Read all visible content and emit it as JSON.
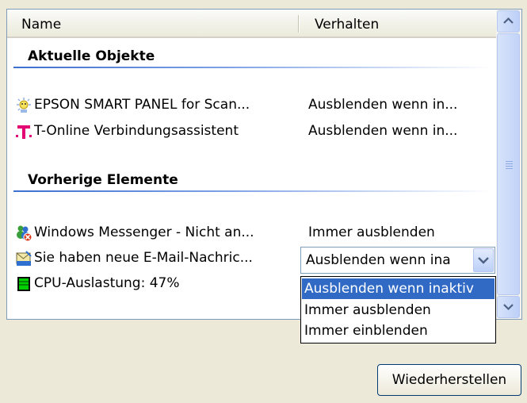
{
  "columns": {
    "name": "Name",
    "behavior": "Verhalten"
  },
  "groups": [
    {
      "title": "Aktuelle Objekte"
    },
    {
      "title": "Vorherige Elemente"
    }
  ],
  "current_items": [
    {
      "name": "EPSON SMART PANEL for Scan...",
      "behavior": "Ausblenden wenn in...",
      "icon": "epson-scanner-icon"
    },
    {
      "name": "T-Online Verbindungsassistent",
      "behavior": "Ausblenden wenn in...",
      "icon": "t-online-icon"
    }
  ],
  "previous_items": [
    {
      "name": "Windows Messenger - Nicht an...",
      "behavior": "Immer ausblenden",
      "icon": "windows-messenger-icon"
    },
    {
      "name": "Sie haben neue E-Mail-Nachric...",
      "behavior": "Ausblenden wenn ina",
      "icon": "new-mail-icon"
    },
    {
      "name": "CPU-Auslastung: 47%",
      "behavior": "",
      "icon": "cpu-meter-icon"
    }
  ],
  "dropdown": {
    "selected": "Ausblenden wenn ina",
    "options": [
      "Ausblenden wenn inaktiv",
      "Immer ausblenden",
      "Immer einblenden"
    ],
    "highlighted_index": 0
  },
  "restore_button": "Wiederherstellen",
  "colors": {
    "selection": "#316ac5",
    "group_line": "#3c6fd0",
    "window_bg": "#ece9d8"
  }
}
